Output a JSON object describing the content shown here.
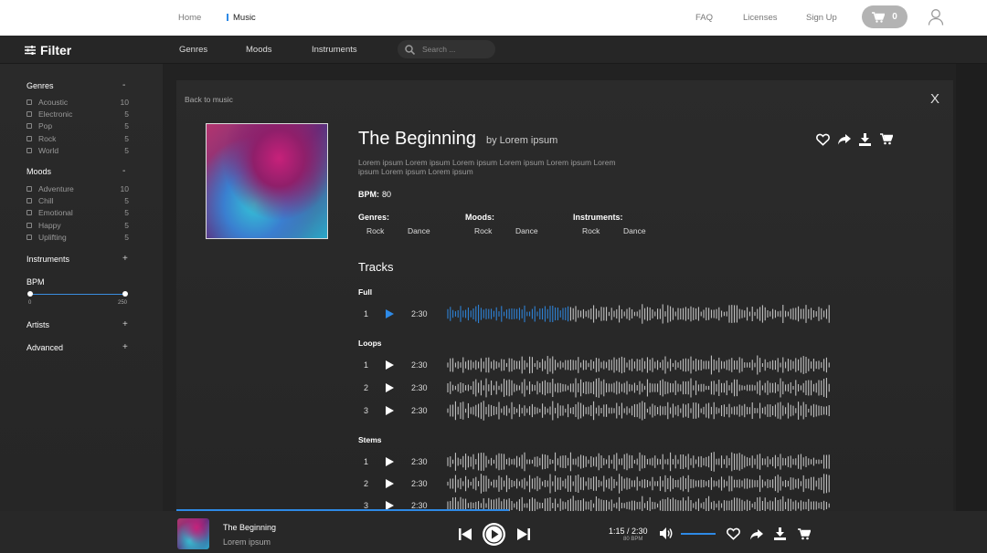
{
  "topnav": {
    "home": "Home",
    "music": "Music",
    "faq": "FAQ",
    "licenses": "Licenses",
    "signup": "Sign Up",
    "cart_count": "0"
  },
  "subnav": {
    "filter": "Filter",
    "genres": "Genres",
    "moods": "Moods",
    "instruments": "Instruments",
    "search_placeholder": "Search ..."
  },
  "sidebar": {
    "genres": {
      "title": "Genres",
      "toggle": "-",
      "items": [
        {
          "label": "Acoustic",
          "count": "10"
        },
        {
          "label": "Electronic",
          "count": "5"
        },
        {
          "label": "Pop",
          "count": "5"
        },
        {
          "label": "Rock",
          "count": "5"
        },
        {
          "label": "World",
          "count": "5"
        }
      ]
    },
    "moods": {
      "title": "Moods",
      "toggle": "-",
      "items": [
        {
          "label": "Adventure",
          "count": "10"
        },
        {
          "label": "Chill",
          "count": "5"
        },
        {
          "label": "Emotional",
          "count": "5"
        },
        {
          "label": "Happy",
          "count": "5"
        },
        {
          "label": "Uplifting",
          "count": "5"
        }
      ]
    },
    "instruments": {
      "title": "Instruments",
      "toggle": "+"
    },
    "bpm": {
      "title": "BPM",
      "min": "0",
      "max": "250"
    },
    "artists": {
      "title": "Artists",
      "toggle": "+"
    },
    "advanced": {
      "title": "Advanced",
      "toggle": "+"
    }
  },
  "detail": {
    "back": "Back to music",
    "close": "X",
    "title": "The Beginning",
    "by": "by Lorem ipsum",
    "desc": "Lorem ipsum Lorem ipsum Lorem ipsum Lorem ipsum Lorem ipsum Lorem ipsum Lorem ipsum Lorem ipsum",
    "bpm_label": "BPM:",
    "bpm_value": "80",
    "genres_label": "Genres:",
    "moods_label": "Moods:",
    "instruments_label": "Instruments:",
    "genres": [
      "Rock",
      "Dance"
    ],
    "moods": [
      "Rock",
      "Dance"
    ],
    "instruments": [
      "Rock",
      "Dance"
    ],
    "tracks_title": "Tracks",
    "groups": [
      {
        "name": "Full",
        "rows": [
          {
            "num": "1",
            "dur": "2:30"
          }
        ]
      },
      {
        "name": "Loops",
        "rows": [
          {
            "num": "1",
            "dur": "2:30"
          },
          {
            "num": "2",
            "dur": "2:30"
          },
          {
            "num": "3",
            "dur": "2:30"
          }
        ]
      },
      {
        "name": "Stems",
        "rows": [
          {
            "num": "1",
            "dur": "2:30"
          },
          {
            "num": "2",
            "dur": "2:30"
          },
          {
            "num": "3",
            "dur": "2:30"
          }
        ]
      }
    ],
    "full_progress": 0.32
  },
  "player": {
    "title": "The Beginning",
    "artist": "Lorem ipsum",
    "time": "1:15 / 2:30",
    "bpm": "80 BPM",
    "progress": 0.5,
    "volume": 0.9
  },
  "colors": {
    "accent": "#2e8ae6"
  },
  "icons": [
    "cart-icon",
    "user-icon",
    "filter-icon",
    "search-icon",
    "heart-icon",
    "share-icon",
    "download-icon",
    "play-icon",
    "prev-icon",
    "next-icon",
    "volume-icon"
  ]
}
